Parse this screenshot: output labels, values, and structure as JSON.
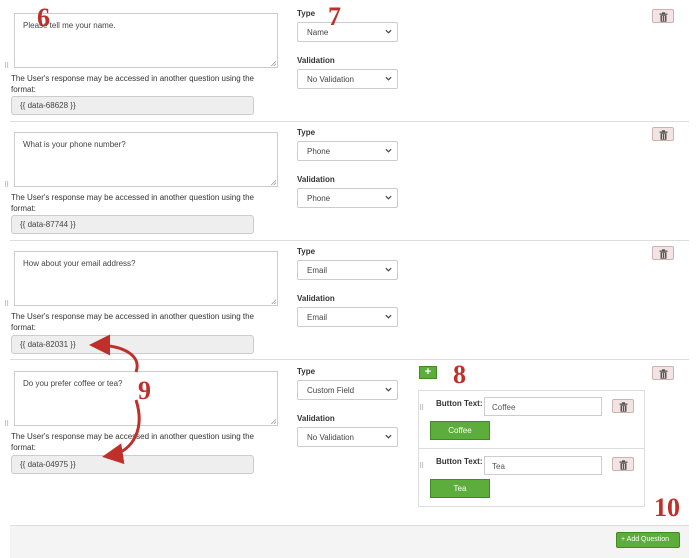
{
  "questions": [
    {
      "prompt": "Please tell me your name.",
      "note": "The User's response may be accessed in another question using the format:",
      "token": "{{ data-68628 }}",
      "type_label": "Type",
      "type_value": "Name",
      "validation_label": "Validation",
      "validation_value": "No Validation"
    },
    {
      "prompt": "What is your phone number?",
      "note": "The User's response may be accessed in another question using the format:",
      "token": "{{ data-87744 }}",
      "type_label": "Type",
      "type_value": "Phone",
      "validation_label": "Validation",
      "validation_value": "Phone"
    },
    {
      "prompt": "How about your email address?",
      "note": "The User's response may be accessed in another question using the format:",
      "token": "{{ data-82031 }}",
      "type_label": "Type",
      "type_value": "Email",
      "validation_label": "Validation",
      "validation_value": "Email"
    },
    {
      "prompt": "Do you prefer coffee or tea?",
      "note": "The User's response may be accessed in another question using the format:",
      "token": "{{ data-04975 }}",
      "type_label": "Type",
      "type_value": "Custom Field",
      "validation_label": "Validation",
      "validation_value": "No Validation"
    }
  ],
  "custom_buttons": [
    {
      "label": "Button Text:",
      "value": "Coffee",
      "preview": "Coffee"
    },
    {
      "label": "Button Text:",
      "value": "Tea",
      "preview": "Tea"
    }
  ],
  "add_button_icon": "+",
  "add_question_label": "+ Add Question",
  "annotations": [
    "6",
    "7",
    "8",
    "9",
    "10"
  ],
  "icons": {
    "delete": "trash-icon",
    "chevron": "chevron-down-icon",
    "drag": "drag-handle-icon"
  },
  "colors": {
    "accent_green": "#5cad3b",
    "annotation_red": "#c0302a",
    "delete_bg": "#f4e3e3"
  }
}
